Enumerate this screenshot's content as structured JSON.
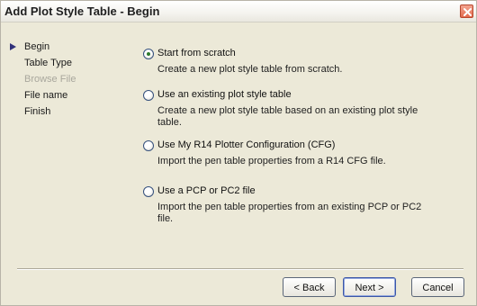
{
  "window": {
    "title": "Add Plot Style Table - Begin"
  },
  "steps": [
    {
      "label": "Begin",
      "state": "current"
    },
    {
      "label": "Table Type",
      "state": "enabled"
    },
    {
      "label": "Browse File",
      "state": "disabled"
    },
    {
      "label": "File name",
      "state": "enabled"
    },
    {
      "label": "Finish",
      "state": "enabled"
    }
  ],
  "options": [
    {
      "label": "Start from scratch",
      "selected": true,
      "desc_lines": [
        "Create a new plot style table from scratch."
      ]
    },
    {
      "label": "Use an existing plot style table",
      "selected": false,
      "desc_lines": [
        "Create a new plot style table based on an existing plot style",
        "table."
      ]
    },
    {
      "label": "Use My R14 Plotter Configuration (CFG)",
      "selected": false,
      "desc_lines": [
        "Import the pen table properties from a R14 CFG file."
      ]
    },
    {
      "label": "Use a PCP or PC2 file",
      "selected": false,
      "desc_lines": [
        "Import the pen table properties from an existing PCP or PC2",
        "file."
      ]
    }
  ],
  "buttons": {
    "back": "< Back",
    "next": "Next >",
    "cancel": "Cancel"
  },
  "colors": {
    "dialog_bg": "#ece9d8",
    "accent": "#30307a",
    "selected_dot": "#2d7a2d",
    "close": "#e36a4d"
  }
}
